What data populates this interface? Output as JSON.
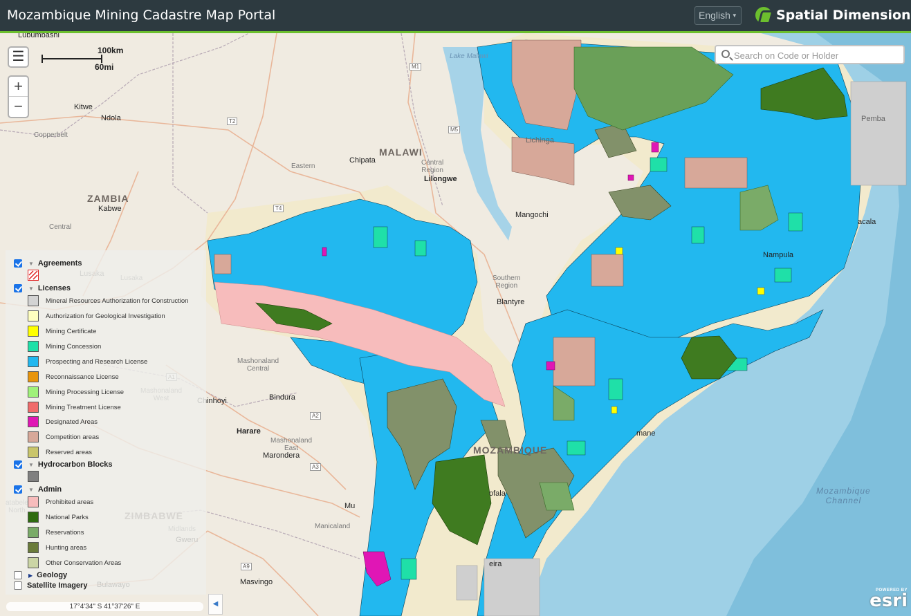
{
  "header": {
    "title": "Mozambique Mining Cadastre Map Portal",
    "language": "English",
    "brand": "Spatial Dimension"
  },
  "search": {
    "placeholder": "Search on Code or Holder"
  },
  "scale": {
    "km": "100km",
    "mi": "60mi"
  },
  "coordinates": "17°4'34\" S  41°37'26\" E",
  "attribution": {
    "powered": "POWERED BY",
    "name": "esri"
  },
  "map_labels": {
    "countries": {
      "malawi": "MALAWI",
      "zambia": "ZAMBIA",
      "zimbabwe": "ZIMBABWE",
      "mozambique": "MOZAMBIQUE"
    },
    "cities": {
      "lubumbashi": "Lubumbashi",
      "kitwe": "Kitwe",
      "ndola": "Ndola",
      "chipata": "Chipata",
      "lilongwe": "Lilongwe",
      "kabwe": "Kabwe",
      "mangochi": "Mangochi",
      "blantyre": "Blantyre",
      "chinhoyi": "Chinhoyi",
      "bindura": "Bindura",
      "harare": "Harare",
      "marondera": "Marondera",
      "gweru": "Gweru",
      "masvingo": "Masvingo",
      "bulawayo": "Bulawayo",
      "lusaka": "Lusaka",
      "nampula": "Nampula",
      "lichinga": "Lichinga",
      "pemba": "Pemba",
      "acala": "acala",
      "mane": "mane",
      "ofala": "ofala",
      "eira": "eira",
      "mu": "Mu"
    },
    "regions": {
      "copperbelt": "Copperbelt",
      "eastern": "Eastern",
      "central_region": "Central\nRegion",
      "central": "Central",
      "southern_region": "Southern\nRegion",
      "mashonaland_central": "Mashonaland\nCentral",
      "mashonaland_west": "Mashonaland\nWest",
      "mashonaland_east": "Mashonaland\nEast",
      "manicaland": "Manicaland",
      "midlands": "Midlands",
      "lusaka_region": "Lusaka",
      "matabeleland_north": "atabele\nNorth"
    },
    "water": {
      "lake_malawi": "Lake Malawi",
      "channel": "Mozambique\nChannel"
    },
    "roads": {
      "m1": "M1",
      "m5": "M5",
      "t2": "T2",
      "t4": "T4",
      "a1": "A1",
      "a2": "A2",
      "a3": "A3",
      "a9": "A9"
    }
  },
  "legend": {
    "groups": [
      {
        "title": "Agreements",
        "checked": true,
        "expanded": true
      },
      {
        "title": "Licenses",
        "checked": true,
        "expanded": true
      },
      {
        "title": "Hydrocarbon Blocks",
        "checked": true,
        "expanded": true
      },
      {
        "title": "Admin",
        "checked": true,
        "expanded": true
      },
      {
        "title": "Geology",
        "checked": false,
        "expanded": false
      },
      {
        "title": "Satellite Imagery",
        "checked": false,
        "expanded": false
      }
    ],
    "licenses": [
      {
        "label": "Mineral Resources Authorization for Construction",
        "color": "#d3d3d3"
      },
      {
        "label": "Authorization for Geological Investigation",
        "color": "#ffffc0"
      },
      {
        "label": "Mining Certificate",
        "color": "#ffff00"
      },
      {
        "label": "Mining Concession",
        "color": "#1fe0a8"
      },
      {
        "label": "Prospecting and Research License",
        "color": "#22b8ef"
      },
      {
        "label": "Reconnaissance License",
        "color": "#e8950c"
      },
      {
        "label": "Mining Processing License",
        "color": "#a0f27a"
      },
      {
        "label": "Mining Treatment License",
        "color": "#f06b6b"
      },
      {
        "label": "Designated Areas",
        "color": "#e016b5"
      },
      {
        "label": "Competition areas",
        "color": "#d7a899"
      },
      {
        "label": "Reserved areas",
        "color": "#c9c56b"
      }
    ],
    "hydrocarbon_color": "#808080",
    "admin": [
      {
        "label": "Prohibited areas",
        "color": "#f7bcbc"
      },
      {
        "label": "National Parks",
        "color": "#2e6b10"
      },
      {
        "label": "Reservations",
        "color": "#7aab68"
      },
      {
        "label": "Hunting areas",
        "color": "#6a7b3a"
      },
      {
        "label": "Other Conservation Areas",
        "color": "#cbd5a5"
      }
    ]
  },
  "colors": {
    "header_bg": "#2d3a40",
    "accent": "#6cbf2e",
    "land": "#f0ebe1",
    "mozambique_land": "#f2eacd",
    "sea": "#9ed0e6",
    "prospecting": "#22b8ef",
    "concession": "#1fe0a8"
  }
}
